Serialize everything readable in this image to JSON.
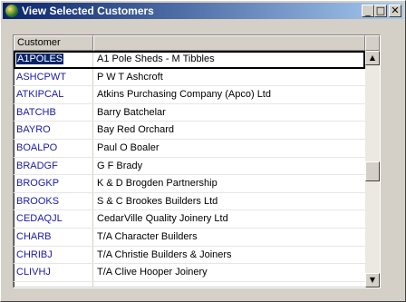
{
  "window": {
    "title": "View Selected Customers",
    "min_glyph": "_",
    "max_glyph": "□",
    "close_glyph": "✕"
  },
  "grid": {
    "columns": [
      "Customer",
      ""
    ],
    "rows": [
      {
        "code": "A1POLES",
        "name": "A1 Pole Sheds - M Tibbles",
        "selected": true
      },
      {
        "code": "ASHCPWT",
        "name": "P W T Ashcroft"
      },
      {
        "code": "ATKIPCAL",
        "name": "Atkins Purchasing Company (Apco) Ltd"
      },
      {
        "code": "BATCHB",
        "name": "Barry Batchelar"
      },
      {
        "code": "BAYRO",
        "name": "Bay Red Orchard"
      },
      {
        "code": "BOALPO",
        "name": "Paul O Boaler"
      },
      {
        "code": "BRADGF",
        "name": "G F Brady"
      },
      {
        "code": "BROGKP",
        "name": "K & D Brogden Partnership"
      },
      {
        "code": "BROOKS",
        "name": "S & C Brookes Builders Ltd"
      },
      {
        "code": "CEDAQJL",
        "name": "CedarVille Quality Joinery Ltd"
      },
      {
        "code": "CHARB",
        "name": "T/A Character Builders"
      },
      {
        "code": "CHRIBJ",
        "name": "T/A Christie Builders & Joiners"
      },
      {
        "code": "CLIVHJ",
        "name": "T/A Clive Hooper Joinery"
      }
    ],
    "scroll_up_glyph": "▲",
    "scroll_down_glyph": "▼"
  },
  "colors": {
    "title_bar_start": "#0a246a",
    "code_text": "#1a1aa8",
    "selection": "#0a246a"
  },
  "icons": [
    "app-icon",
    "minimize-icon",
    "maximize-icon",
    "close-icon",
    "scroll-up-arrow-icon",
    "scroll-down-arrow-icon"
  ]
}
